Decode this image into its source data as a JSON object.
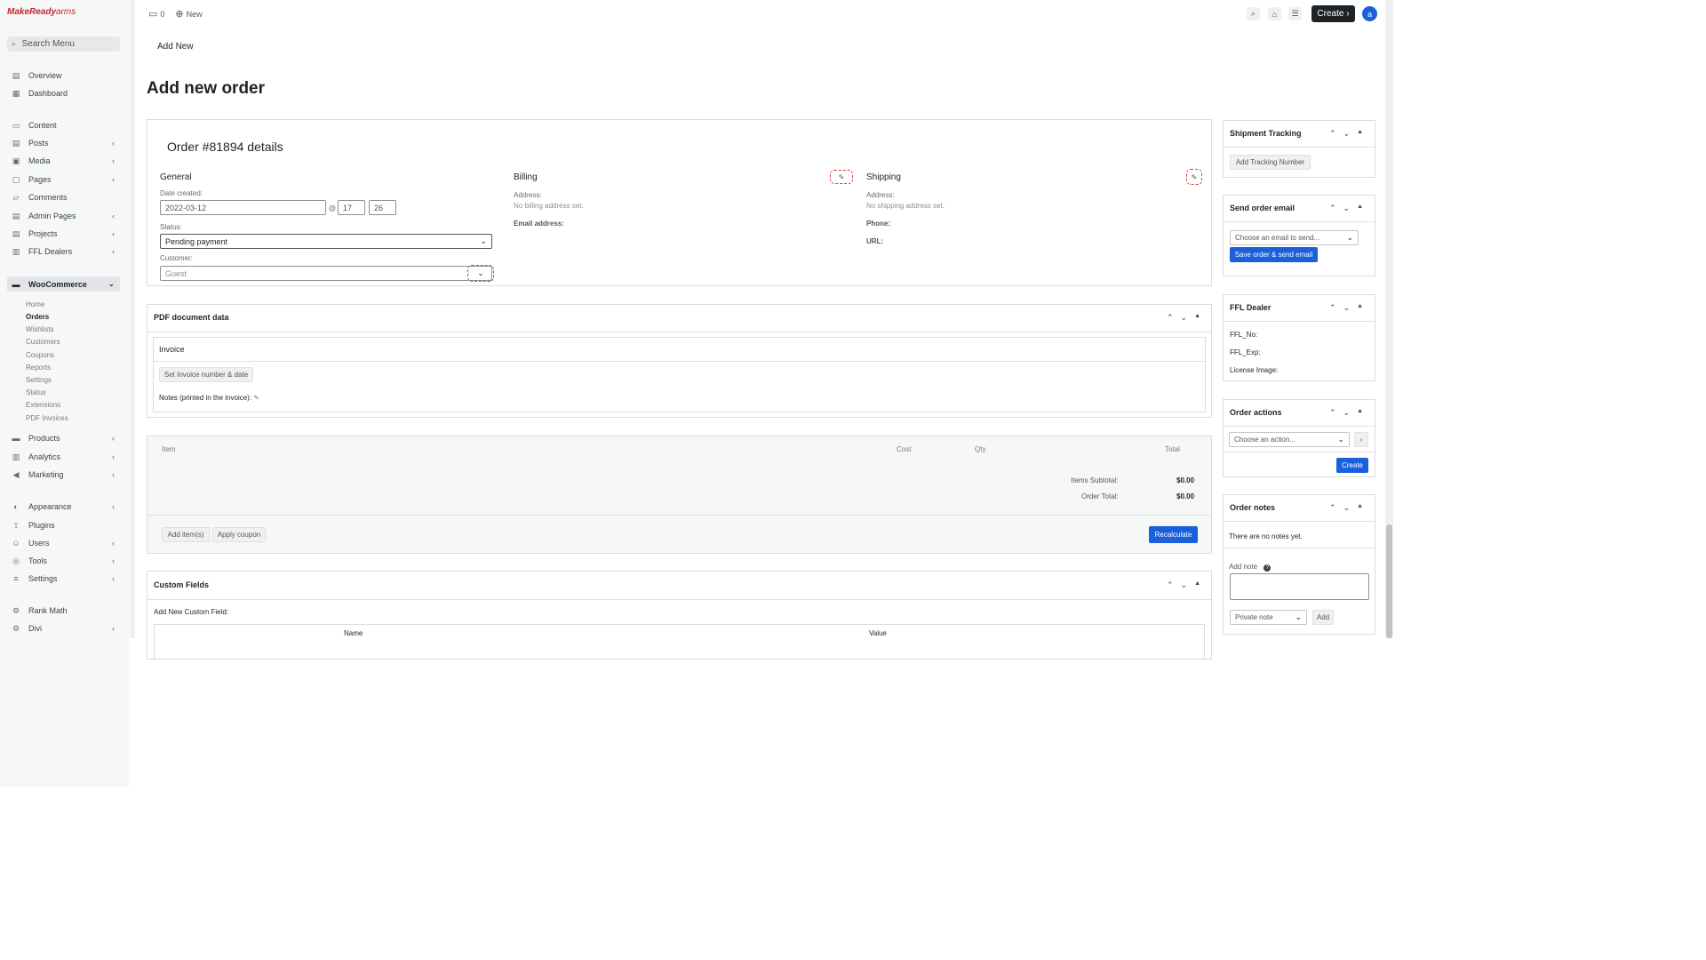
{
  "sidebar": {
    "logo": {
      "brand_a": "MakeReady",
      "brand_b": "arms"
    },
    "search_label": "Search Menu",
    "items": [
      {
        "label": "Overview",
        "icon": "overview-icon"
      },
      {
        "label": "Dashboard",
        "icon": "dashboard-icon"
      },
      {
        "label": "Content",
        "icon": "content-icon"
      },
      {
        "label": "Posts",
        "icon": "posts-icon"
      },
      {
        "label": "Media",
        "icon": "media-icon"
      },
      {
        "label": "Pages",
        "icon": "pages-icon"
      },
      {
        "label": "Comments",
        "icon": "comments-icon"
      },
      {
        "label": "Admin Pages",
        "icon": "admin-pages-icon"
      },
      {
        "label": "Projects",
        "icon": "projects-icon"
      },
      {
        "label": "FFL Dealers",
        "icon": "ffl-dealers-icon"
      },
      {
        "label": "WooCommerce",
        "icon": "woocommerce-icon"
      },
      {
        "label": "Products",
        "icon": "products-icon"
      },
      {
        "label": "Analytics",
        "icon": "analytics-icon"
      },
      {
        "label": "Marketing",
        "icon": "marketing-icon"
      },
      {
        "label": "Appearance",
        "icon": "appearance-icon"
      },
      {
        "label": "Plugins",
        "icon": "plugins-icon"
      },
      {
        "label": "Users",
        "icon": "users-icon"
      },
      {
        "label": "Tools",
        "icon": "tools-icon"
      },
      {
        "label": "Settings",
        "icon": "settings-icon"
      },
      {
        "label": "Rank Math",
        "icon": "rank-math-icon"
      },
      {
        "label": "Divi",
        "icon": "divi-icon"
      }
    ],
    "woo_sub": [
      "Home",
      "Orders",
      "Wishlists",
      "Customers",
      "Coupons",
      "Reports",
      "Settings",
      "Status",
      "Extensions",
      "PDF Invoices"
    ]
  },
  "topbar": {
    "comments_count": "0",
    "new_label": "New",
    "create_label": "Create",
    "avatar_initial": "a"
  },
  "page": {
    "add_new": "Add New",
    "title": "Add new order"
  },
  "order": {
    "heading": "Order #81894 details",
    "general_title": "General",
    "date_created_label": "Date created:",
    "date_value": "2022-03-12",
    "at_sign": "@",
    "hour": "17",
    "minute": "26",
    "status_label": "Status:",
    "status_value": "Pending payment",
    "customer_label": "Customer:",
    "customer_value": "Guest",
    "billing_title": "Billing",
    "billing_address_label": "Address:",
    "billing_address_value": "No billing address set.",
    "billing_email_label": "Email address:",
    "shipping_title": "Shipping",
    "shipping_address_label": "Address:",
    "shipping_address_value": "No shipping address set.",
    "shipping_phone_label": "Phone:",
    "shipping_url_label": "URL:"
  },
  "pdf": {
    "title": "PDF document data",
    "invoice_title": "Invoice",
    "set_button": "Set Invoice number & date",
    "notes_label": "Notes (printed in the invoice):"
  },
  "items": {
    "headers": {
      "item": "Item",
      "cost": "Cost",
      "qty": "Qty",
      "total": "Total"
    },
    "subtotal_label": "Items Subtotal:",
    "subtotal_value": "$0.00",
    "order_total_label": "Order Total:",
    "order_total_value": "$0.00",
    "add_items": "Add item(s)",
    "apply_coupon": "Apply coupon",
    "recalculate": "Recalculate"
  },
  "custom_fields": {
    "title": "Custom Fields",
    "add_new_label": "Add New Custom Field:",
    "col_name": "Name",
    "col_value": "Value"
  },
  "right": {
    "shipment_title": "Shipment Tracking",
    "add_tracking": "Add Tracking Number",
    "send_email_title": "Send order email",
    "email_placeholder": "Choose an email to send...",
    "save_send": "Save order & send email",
    "ffl_title": "FFL Dealer",
    "ffl_no": "FFL_No:",
    "ffl_exp": "FFL_Exp:",
    "license_image": "License Image:",
    "actions_title": "Order actions",
    "action_placeholder": "Choose an action...",
    "create_button": "Create",
    "notes_title": "Order notes",
    "no_notes": "There are no notes yet.",
    "add_note_label": "Add note",
    "note_type": "Private note",
    "add_button": "Add"
  },
  "colors": {
    "accent": "#1a5fdb",
    "dark": "#1d2327",
    "highlight": "#e23b3b"
  }
}
